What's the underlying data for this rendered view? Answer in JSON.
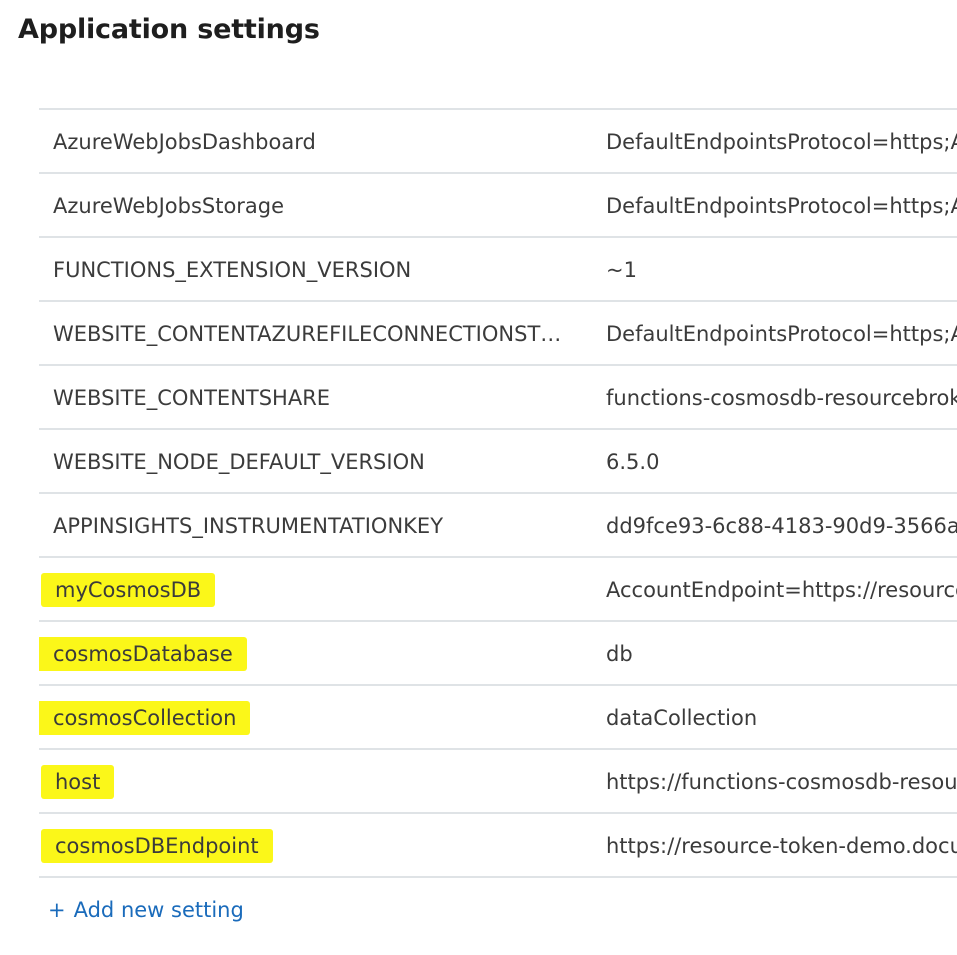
{
  "section_title": "Application settings",
  "settings": [
    {
      "name": "AzureWebJobsDashboard",
      "value": "DefaultEndpointsProtocol=https;AccountName=",
      "highlighted": false
    },
    {
      "name": "AzureWebJobsStorage",
      "value": "DefaultEndpointsProtocol=https;AccountName=",
      "highlighted": false
    },
    {
      "name": "FUNCTIONS_EXTENSION_VERSION",
      "value": "~1",
      "highlighted": false
    },
    {
      "name": "WEBSITE_CONTENTAZUREFILECONNECTIONSTR...",
      "value": "DefaultEndpointsProtocol=https;AccountName=",
      "highlighted": false
    },
    {
      "name": "WEBSITE_CONTENTSHARE",
      "value": "functions-cosmosdb-resourcebroker",
      "highlighted": false
    },
    {
      "name": "WEBSITE_NODE_DEFAULT_VERSION",
      "value": "6.5.0",
      "highlighted": false
    },
    {
      "name": "APPINSIGHTS_INSTRUMENTATIONKEY",
      "value": "dd9fce93-6c88-4183-90d9-3566a",
      "highlighted": false
    },
    {
      "name": "myCosmosDB",
      "value": "AccountEndpoint=https://resource",
      "highlighted": true
    },
    {
      "name": "cosmosDatabase",
      "value": "db",
      "highlighted": true
    },
    {
      "name": "cosmosCollection",
      "value": "dataCollection",
      "highlighted": true
    },
    {
      "name": "host",
      "value": "https://functions-cosmosdb-resource",
      "highlighted": true
    },
    {
      "name": "cosmosDBEndpoint",
      "value": "https://resource-token-demo.documents",
      "highlighted": true
    }
  ],
  "add_setting": {
    "icon": "plus-icon",
    "plus_glyph": "+",
    "label": "Add new setting"
  },
  "colors": {
    "highlight": "#fbf719",
    "link": "#1a6bbb",
    "divider": "#dfe3e6"
  }
}
